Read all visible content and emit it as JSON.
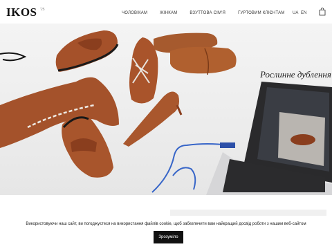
{
  "header": {
    "logo": "IKOS",
    "logo_sup": "'25",
    "nav": [
      "ЧОЛОВІКАМ",
      "ЖІНКАМ",
      "ВЗУТТОВА СІМ'Я",
      "ГУРТОВИМ КЛІЄНТАМ"
    ],
    "lang_ua": "UA",
    "lang_en": "EN"
  },
  "hero": {
    "caption": "Рослинне дублення"
  },
  "cookie": {
    "text": "Використовуючи наш сайт, ви погоджуєтеся на використання файлів cookie, щоб забезпечити вам найкращий досвід роботи з нашим веб-сайтом",
    "button": "Зрозуміло"
  },
  "colors": {
    "leather": "#a5512a",
    "cookie_button": "#111111"
  }
}
